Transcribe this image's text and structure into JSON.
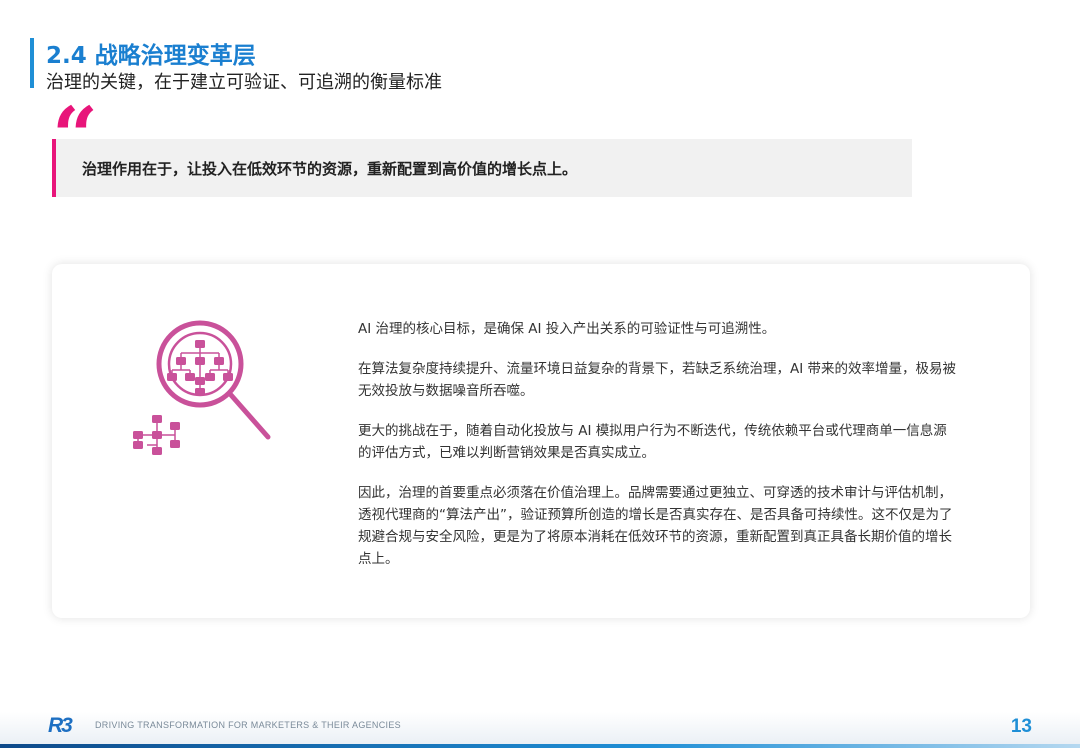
{
  "header": {
    "title": "2.4 战略治理变革层",
    "subtitle": "治理的关键，在于建立可验证、可追溯的衡量标准"
  },
  "quote": {
    "mark": "“",
    "text": "治理作用在于，让投入在低效环节的资源，重新配置到高价值的增长点上。"
  },
  "card": {
    "icon": "governance-magnifier-flowchart-icon",
    "paragraphs": [
      "AI 治理的核心目标，是确保 AI 投入产出关系的可验证性与可追溯性。",
      "在算法复杂度持续提升、流量环境日益复杂的背景下，若缺乏系统治理，AI 带来的效率增量，极易被无效投放与数据噪音所吞噬。",
      "更大的挑战在于，随着自动化投放与 AI 模拟用户行为不断迭代，传统依赖平台或代理商单一信息源的评估方式，已难以判断营销效果是否真实成立。",
      "因此，治理的首要重点必须落在价值治理上。品牌需要通过更独立、可穿透的技术审计与评估机制，透视代理商的“算法产出”，验证预算所创造的增长是否真实存在、是否具备可持续性。这不仅是为了规避合规与安全风险，更是为了将原本消耗在低效环节的资源，重新配置到真正具备长期价值的增长点上。"
    ]
  },
  "footer": {
    "logo": "R3",
    "tagline": "DRIVING TRANSFORMATION FOR MARKETERS & THEIR AGENCIES",
    "page_number": "13"
  },
  "colors": {
    "title_blue": "#1a7fd0",
    "accent_pink": "#e8157a",
    "icon_pink": "#c9519a"
  }
}
